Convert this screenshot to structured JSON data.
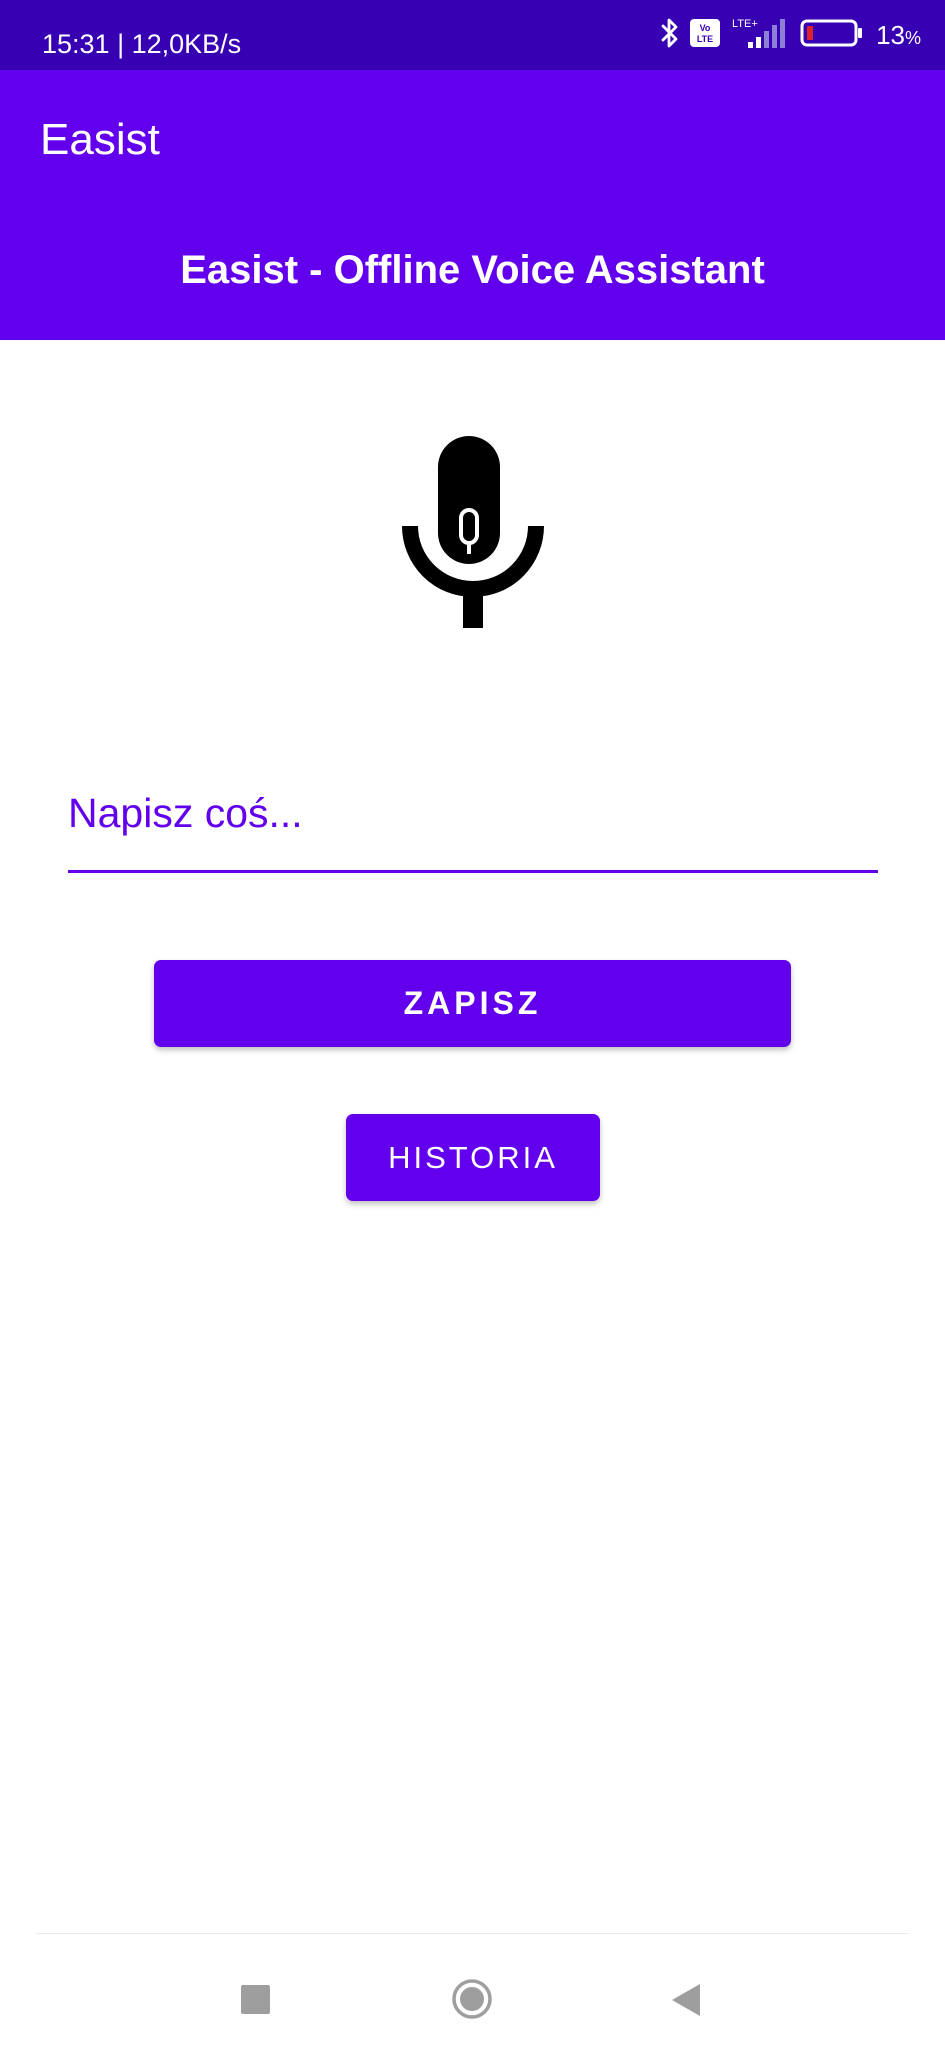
{
  "status_bar": {
    "time_speed": "15:31 | 12,0KB/s",
    "network_label": "LTE+",
    "volte_label": "Vo LTE",
    "battery_percent": "13",
    "battery_unit": "%",
    "icons": [
      "bluetooth-icon",
      "volte-icon",
      "signal-icon",
      "battery-icon"
    ]
  },
  "app_bar": {
    "title": "Easist",
    "subtitle": "Easist - Offline Voice Assistant"
  },
  "main": {
    "mic_icon": "microphone-icon",
    "input": {
      "value": "",
      "placeholder": "Napisz coś..."
    },
    "save_button": "ZAPISZ",
    "history_button": "HISTORIA"
  },
  "nav_bar": {
    "icons": [
      "recents-icon",
      "home-icon",
      "back-icon"
    ]
  },
  "colors": {
    "primary": "#6200ee",
    "primary_dark": "#3700b3",
    "on_primary": "#ffffff",
    "background": "#ffffff",
    "nav_icon": "#9e9e9e"
  }
}
